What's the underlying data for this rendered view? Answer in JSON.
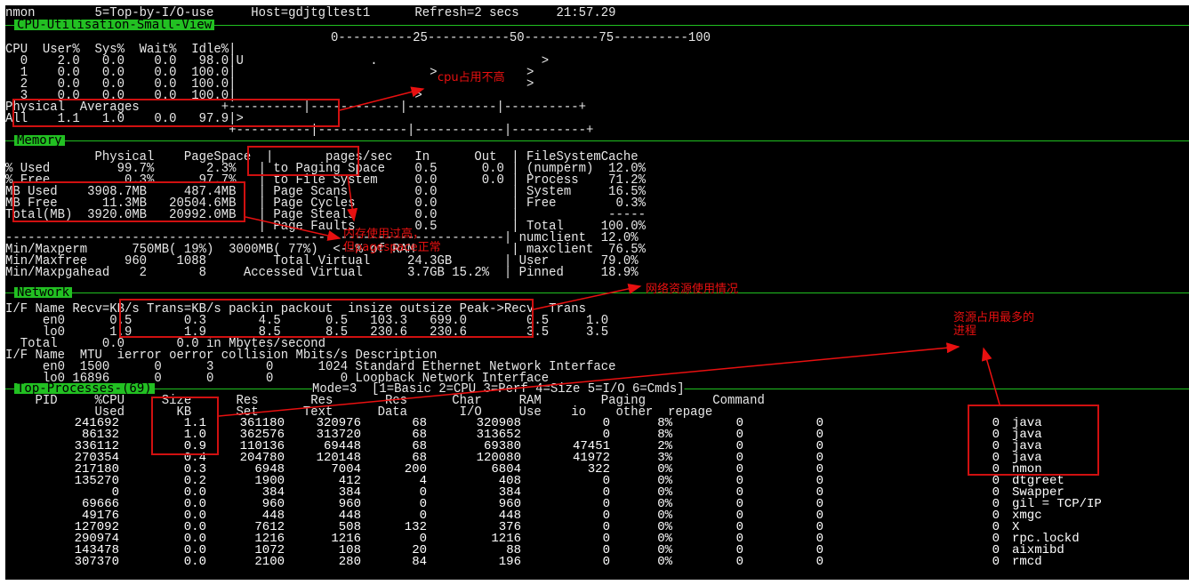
{
  "title_bar": {
    "text": "nmon        5=Top-by-I/O-use     Host=gdjtgltest1      Refresh=2 secs     21:57.29"
  },
  "cpu": {
    "header": "CPU-Utilisation-Small-View",
    "scale": "0----------25-----------50----------75----------100",
    "lines": [
      "CPU  User%  Sys%  Wait%  Idle%|",
      "  0    2.0   0.0    0.0   98.0|U                 .                      >",
      "  1    0.0   0.0    0.0  100.0|                          >            >",
      "  2    0.0   0.0    0.0  100.0|                                       >",
      "  3    0.0   0.0    0.0  100.0|                        >",
      "Physical  Averages           +----------|------------|------------|----------+",
      "All    1.1   1.0    0.0   97.9|>",
      "                              +----------|------------|------------|----------+"
    ]
  },
  "memory": {
    "header": "Memory",
    "lines": [
      "            Physical    PageSpace  |       pages/sec   In      Out  | FileSystemCache",
      "% Used         99.7%       2.3%   | to Paging Space    0.5      0.0 | (numperm)  12.0%",
      "% Free          0.3%      97.7%   | to File System     0.0      0.0 | Process    71.2%",
      "MB Used    3908.7MB     487.4MB   | Page Scans         0.0          | System     16.5%",
      "MB Free      11.3MB   20504.6MB   | Page Cycles        0.0          | Free        0.3%",
      "Total(MB)  3920.0MB   20992.0MB   | Page Steals        0.0          |            -----",
      "                                  | Page Faults        0.5          | Total     100.0%",
      "-------------------------------------------------------------------| numclient  12.0%",
      "Min/Maxperm      750MB( 19%)  3000MB( 77%)  <--% of RAM             | maxclient  76.5%",
      "Min/Maxfree     960    1088         Total Virtual     24.3GB       | User       79.0%",
      "Min/Maxpgahead    2       8     Accessed Virtual      3.7GB 15.2%  | Pinned     18.9%"
    ]
  },
  "network": {
    "header": "Network",
    "lines": [
      "I/F Name Recv=KB/s Trans=KB/s packin packout  insize outsize Peak->Recv  Trans",
      "     en0      0.5       0.3       4.5      0.5   103.3   699.0        0.5     1.0",
      "     lo0      1.9       1.9       8.5      8.5   230.6   230.6        3.5     3.5",
      "  Total      0.0       0.0 in Mbytes/second",
      "I/F Name  MTU  ierror oerror collision Mbits/s Description",
      "     en0  1500      0      3       0      1024 Standard Ethernet Network Interface",
      "     lo0 16896      0      0       0         0 Loopback Network Interface"
    ]
  },
  "top": {
    "header": "Top-Processes-(69)",
    "mode": "Mode=3  [1=Basic 2=CPU 3=Perf 4=Size 5=I/O 6=Cmds]",
    "head1": "    PID     %CPU     Size      Res       Res       Res      Char     RAM        Paging         Command",
    "head2": "            Used       KB      Set      Text      Data       I/O     Use    io    other  repage",
    "rows": [
      {
        "pid": "241692",
        "cpu": "1.1",
        "size": "361180",
        "res_set": "320976",
        "res_text": "68",
        "res_data": "320908",
        "char_io": "0",
        "ram": "8%",
        "io": "0",
        "other": "0",
        "repage": "0",
        "command": "java"
      },
      {
        "pid": "86132",
        "cpu": "1.0",
        "size": "362576",
        "res_set": "313720",
        "res_text": "68",
        "res_data": "313652",
        "char_io": "0",
        "ram": "8%",
        "io": "0",
        "other": "0",
        "repage": "0",
        "command": "java"
      },
      {
        "pid": "336112",
        "cpu": "0.9",
        "size": "110136",
        "res_set": "69448",
        "res_text": "68",
        "res_data": "69380",
        "char_io": "47451",
        "ram": "2%",
        "io": "0",
        "other": "0",
        "repage": "0",
        "command": "java"
      },
      {
        "pid": "270354",
        "cpu": "0.4",
        "size": "204780",
        "res_set": "120148",
        "res_text": "68",
        "res_data": "120080",
        "char_io": "41972",
        "ram": "3%",
        "io": "0",
        "other": "0",
        "repage": "0",
        "command": "java"
      },
      {
        "pid": "217180",
        "cpu": "0.3",
        "size": "6948",
        "res_set": "7004",
        "res_text": "200",
        "res_data": "6804",
        "char_io": "322",
        "ram": "0%",
        "io": "0",
        "other": "0",
        "repage": "0",
        "command": "nmon"
      },
      {
        "pid": "135270",
        "cpu": "0.2",
        "size": "1900",
        "res_set": "412",
        "res_text": "4",
        "res_data": "408",
        "char_io": "0",
        "ram": "0%",
        "io": "0",
        "other": "0",
        "repage": "0",
        "command": "dtgreet"
      },
      {
        "pid": "0",
        "cpu": "0.0",
        "size": "384",
        "res_set": "384",
        "res_text": "0",
        "res_data": "384",
        "char_io": "0",
        "ram": "0%",
        "io": "0",
        "other": "0",
        "repage": "0",
        "command": "Swapper"
      },
      {
        "pid": "69666",
        "cpu": "0.0",
        "size": "960",
        "res_set": "960",
        "res_text": "0",
        "res_data": "960",
        "char_io": "0",
        "ram": "0%",
        "io": "0",
        "other": "0",
        "repage": "0",
        "command": "gil = TCP/IP"
      },
      {
        "pid": "49176",
        "cpu": "0.0",
        "size": "448",
        "res_set": "448",
        "res_text": "0",
        "res_data": "448",
        "char_io": "0",
        "ram": "0%",
        "io": "0",
        "other": "0",
        "repage": "0",
        "command": "xmgc"
      },
      {
        "pid": "127092",
        "cpu": "0.0",
        "size": "7612",
        "res_set": "508",
        "res_text": "132",
        "res_data": "376",
        "char_io": "0",
        "ram": "0%",
        "io": "0",
        "other": "0",
        "repage": "0",
        "command": "X"
      },
      {
        "pid": "290974",
        "cpu": "0.0",
        "size": "1216",
        "res_set": "1216",
        "res_text": "0",
        "res_data": "1216",
        "char_io": "0",
        "ram": "0%",
        "io": "0",
        "other": "0",
        "repage": "0",
        "command": "rpc.lockd"
      },
      {
        "pid": "143478",
        "cpu": "0.0",
        "size": "1072",
        "res_set": "108",
        "res_text": "20",
        "res_data": "88",
        "char_io": "0",
        "ram": "0%",
        "io": "0",
        "other": "0",
        "repage": "0",
        "command": "aixmibd"
      },
      {
        "pid": "307370",
        "cpu": "0.0",
        "size": "2100",
        "res_set": "280",
        "res_text": "84",
        "res_data": "196",
        "char_io": "0",
        "ram": "0%",
        "io": "0",
        "other": "0",
        "repage": "0",
        "command": "rmcd"
      }
    ]
  },
  "annotations": {
    "cpu_note": "cpu占用不高",
    "mem_note_1": "内存使用过高，",
    "mem_note_2": "但pagespace正常",
    "net_note": "网络资源使用情况",
    "proc_note_1": "资源占用最多的",
    "proc_note_2": "进程"
  },
  "colors": {
    "terminal_bg": "#000000",
    "text": "#e8e8e8",
    "section_header": "#22c022",
    "annotation": "#e81010"
  }
}
